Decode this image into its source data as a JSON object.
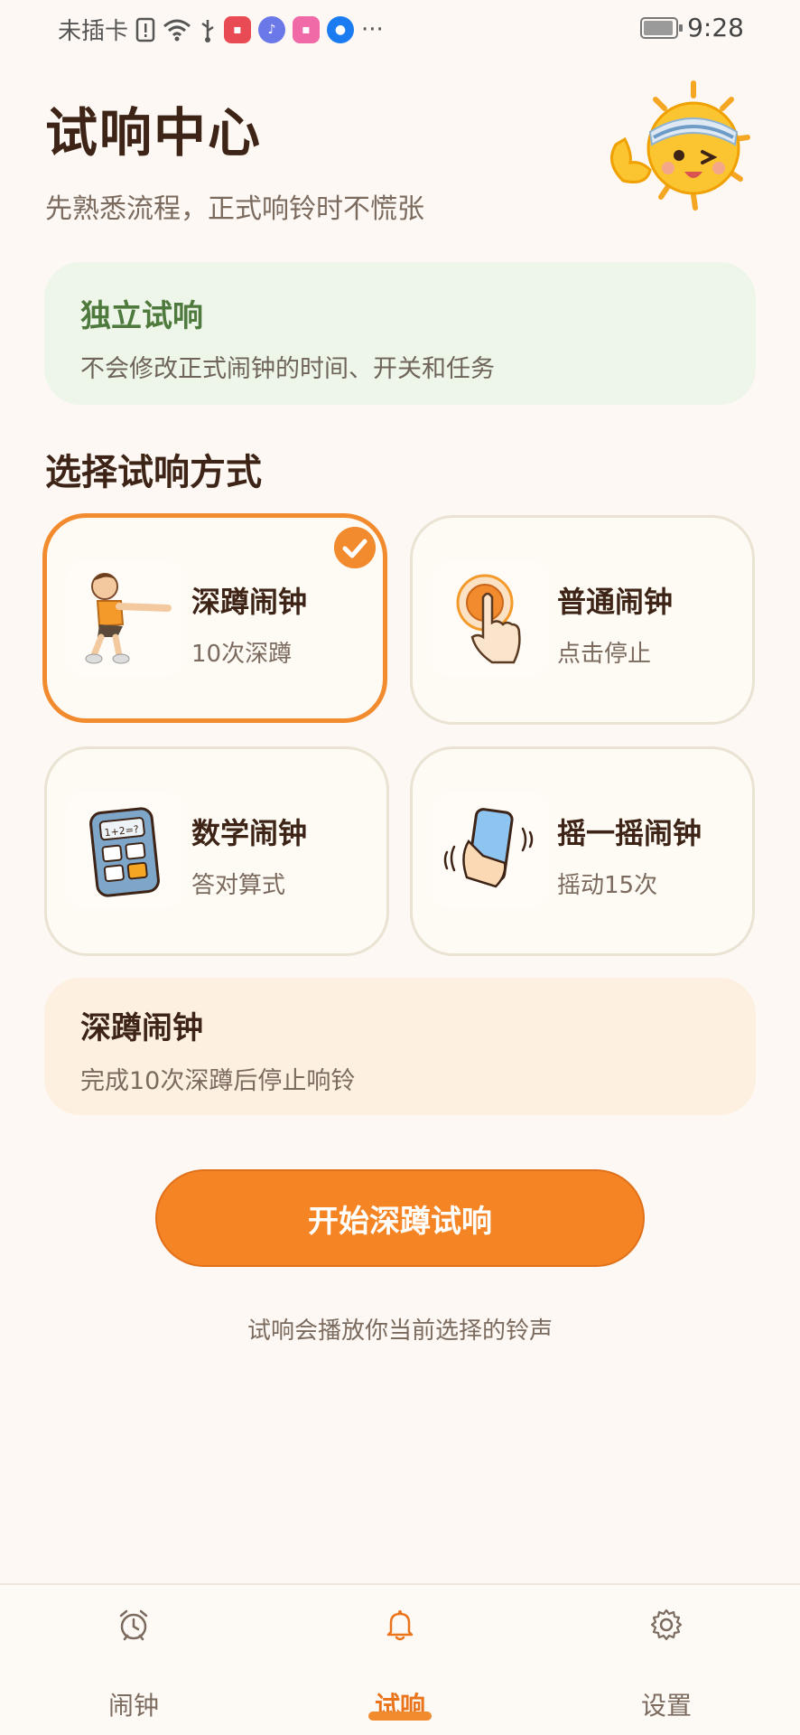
{
  "status_bar": {
    "carrier": "未插卡",
    "time": "9:28",
    "more": "···"
  },
  "header": {
    "title": "试响中心",
    "subtitle": "先熟悉流程，正式响铃时不慌张"
  },
  "independent": {
    "title": "独立试响",
    "description": "不会修改正式闹钟的时间、开关和任务"
  },
  "section_title": "选择试响方式",
  "modes": [
    {
      "name": "深蹲闹钟",
      "description": "10次深蹲",
      "selected": true
    },
    {
      "name": "普通闹钟",
      "description": "点击停止",
      "selected": false
    },
    {
      "name": "数学闹钟",
      "description": "答对算式",
      "selected": false
    },
    {
      "name": "摇一摇闹钟",
      "description": "摇动15次",
      "selected": false
    }
  ],
  "selected_detail": {
    "title": "深蹲闹钟",
    "description": "完成10次深蹲后停止响铃"
  },
  "start_button": "开始深蹲试响",
  "hint": "试响会播放你当前选择的铃声",
  "bottom_nav": [
    {
      "label": "闹钟",
      "icon": "alarm-clock-icon",
      "active": false
    },
    {
      "label": "试响",
      "icon": "bell-icon",
      "active": true
    },
    {
      "label": "设置",
      "icon": "gear-icon",
      "active": false
    }
  ],
  "colors": {
    "accent": "#f28a2e",
    "button": "#f58524",
    "background": "#fdf8f3",
    "green_card": "#eef6ea",
    "detail_card": "#fdf0e1"
  }
}
